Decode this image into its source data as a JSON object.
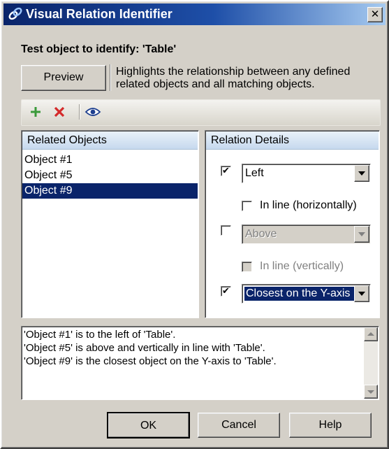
{
  "window": {
    "title": "Visual Relation Identifier",
    "close_glyph": "✕"
  },
  "heading": "Test object to identify: 'Table'",
  "preview": {
    "button_label": "Preview",
    "description_line1": "Highlights the relationship between any defined",
    "description_line2": "related objects and all matching objects."
  },
  "toolbar": {
    "icons": [
      "add-icon",
      "delete-icon",
      "eye-icon"
    ]
  },
  "related_objects": {
    "header": "Related Objects",
    "items": [
      {
        "label": "Object #1",
        "selected": false
      },
      {
        "label": "Object #5",
        "selected": false
      },
      {
        "label": "Object #9",
        "selected": true
      }
    ]
  },
  "relation_details": {
    "header": "Relation Details",
    "horizontal": {
      "checked": true,
      "value": "Left",
      "inline_label": "In line (horizontally)",
      "inline_checked": false
    },
    "vertical": {
      "checked": false,
      "value": "Above",
      "inline_label": "In line (vertically)",
      "inline_checked": false
    },
    "proximity": {
      "checked": true,
      "value": "Closest on the Y-axis"
    }
  },
  "summary": {
    "lines": [
      "'Object #1' is to the left of 'Table'.",
      "'Object #5' is above and vertically in line with 'Table'.",
      "'Object #9' is the closest object on the Y-axis to 'Table'."
    ]
  },
  "buttons": {
    "ok": "OK",
    "cancel": "Cancel",
    "help": "Help"
  },
  "colors": {
    "title_bar": "#0a246a",
    "selection": "#0a246a",
    "dialog_face": "#d4d0c8",
    "add_icon": "#3a9a3a",
    "delete_icon": "#d42a2a"
  }
}
